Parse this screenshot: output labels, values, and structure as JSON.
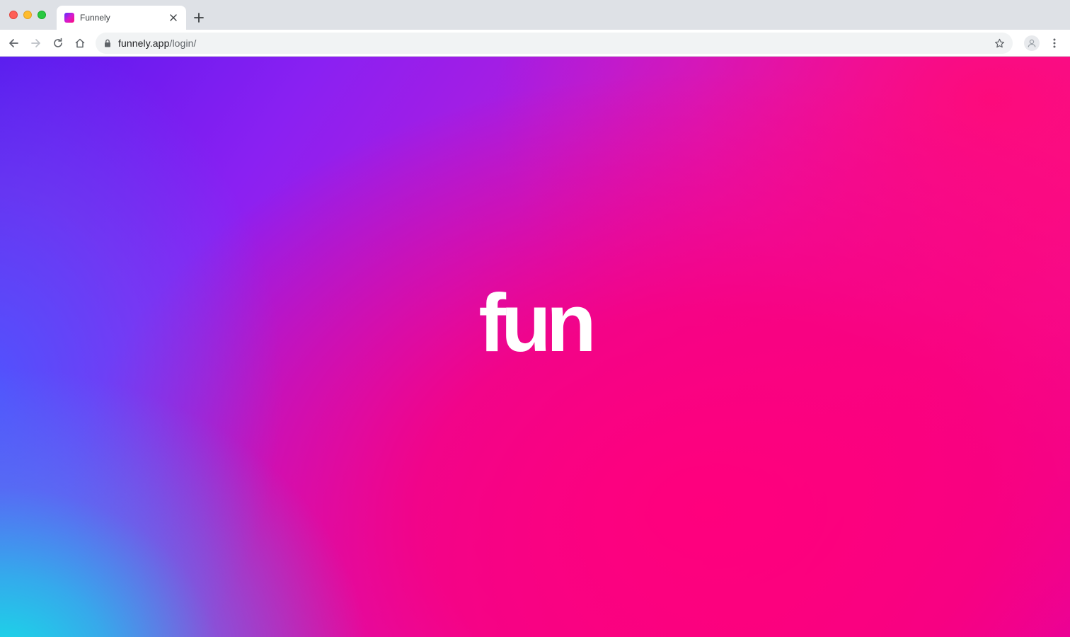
{
  "browser": {
    "tab": {
      "title": "Funnely",
      "favicon_icon": "funnely-gradient-square-icon"
    },
    "address_bar": {
      "host": "funnely.app",
      "path": "/login/"
    },
    "icons": {
      "back": "back-arrow-icon",
      "forward": "forward-arrow-icon",
      "reload": "reload-icon",
      "home": "home-icon",
      "lock": "lock-icon",
      "bookmark": "star-icon",
      "profile": "profile-icon",
      "menu": "kebab-menu-icon",
      "new_tab": "plus-icon",
      "close_tab": "close-icon"
    }
  },
  "page": {
    "logo_text": "fun",
    "background_colors": {
      "violet": "#5a18ee",
      "purple": "#b21cdc",
      "pink": "#f80a86",
      "cyan": "#14e1e6",
      "magenta": "#d200be"
    }
  }
}
